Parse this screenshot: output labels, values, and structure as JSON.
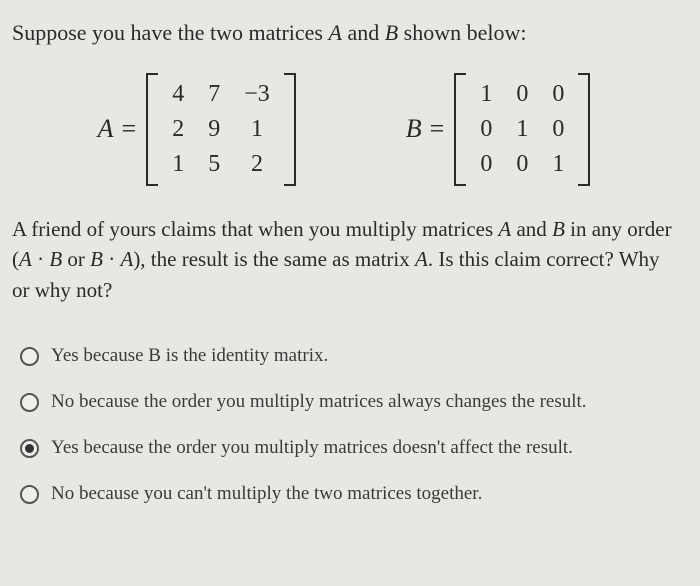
{
  "intro_before": "Suppose you have the two matrices ",
  "intro_var1": "A",
  "intro_mid": " and ",
  "intro_var2": "B",
  "intro_after": " shown below:",
  "matrixA": {
    "name": "A",
    "rows": [
      [
        "4",
        "7",
        "−3"
      ],
      [
        "2",
        "9",
        "1"
      ],
      [
        "1",
        "5",
        "2"
      ]
    ]
  },
  "matrixB": {
    "name": "B",
    "rows": [
      [
        "1",
        "0",
        "0"
      ],
      [
        "0",
        "1",
        "0"
      ],
      [
        "0",
        "0",
        "1"
      ]
    ]
  },
  "eq_sign": "=",
  "question_parts": {
    "p1": "A friend of yours claims that when you multiply matrices ",
    "v1": "A",
    "p2": " and ",
    "v2": "B",
    "p3": " in any order (",
    "v3": "A",
    "p4": " · ",
    "v4": "B",
    "p5": " or ",
    "v5": "B",
    "p6": " · ",
    "v6": "A",
    "p7": "), the result is the same as matrix ",
    "v7": "A",
    "p8": ". Is this claim correct? Why or why not?"
  },
  "options": [
    {
      "label": "Yes because B is the identity matrix.",
      "selected": false
    },
    {
      "label": "No because the order you multiply matrices always changes the result.",
      "selected": false
    },
    {
      "label": "Yes because the order you multiply matrices doesn't affect the result.",
      "selected": true
    },
    {
      "label": "No because you can't multiply the two matrices together.",
      "selected": false
    }
  ]
}
